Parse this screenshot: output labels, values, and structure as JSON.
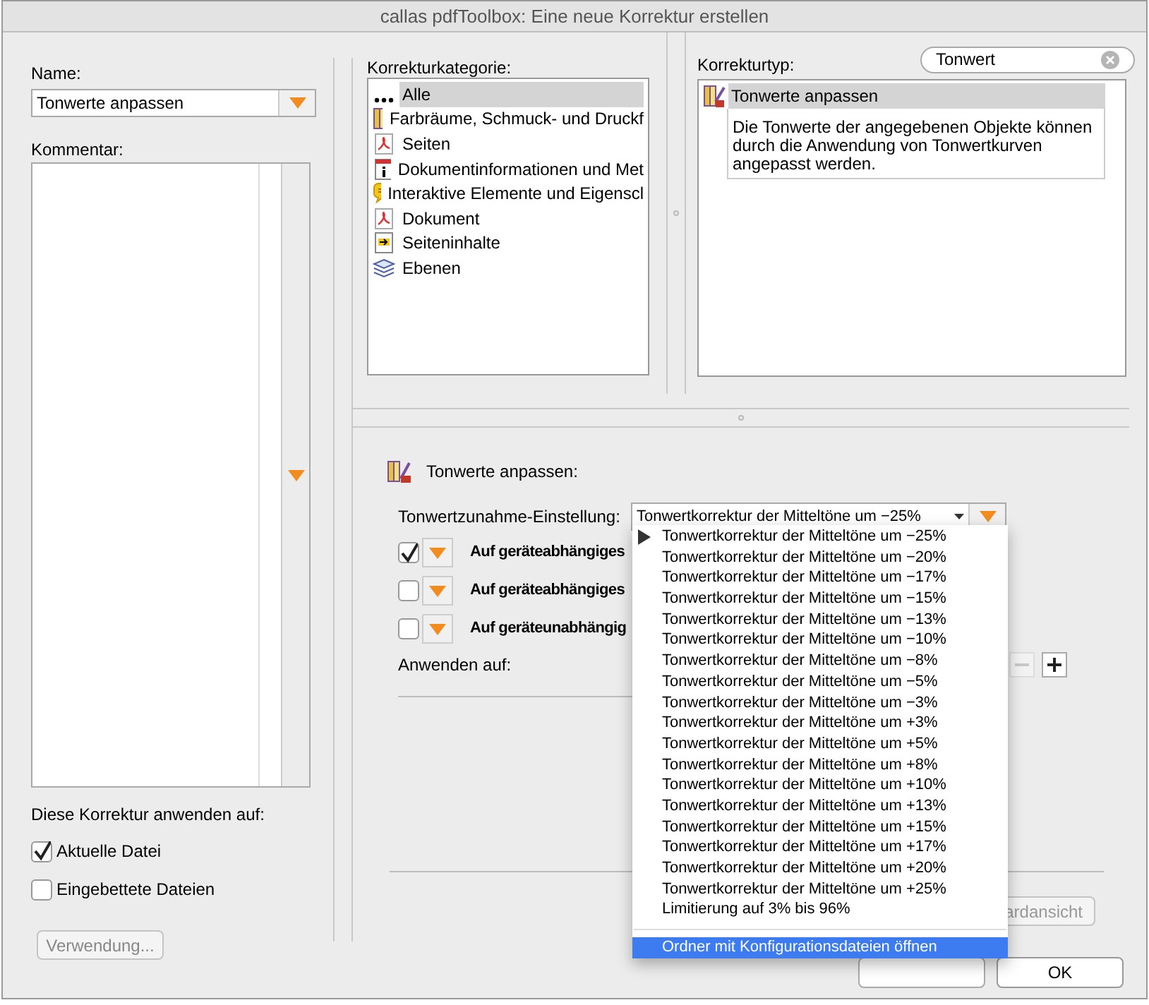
{
  "window": {
    "title": "callas pdfToolbox: Eine neue Korrektur erstellen"
  },
  "left": {
    "name_label": "Name:",
    "name_value": "Tonwerte anpassen",
    "comment_label": "Kommentar:",
    "apply_label": "Diese Korrektur anwenden auf:",
    "targets": [
      {
        "label": "Aktuelle Datei",
        "checked": true
      },
      {
        "label": "Eingebettete Dateien",
        "checked": false
      }
    ],
    "usage_button": {
      "label": "Verwendung...",
      "disabled": true
    }
  },
  "categories": {
    "label": "Korrekturkategorie:",
    "items": [
      {
        "label": "Alle",
        "kind": "dots",
        "selected": true
      },
      {
        "label": "Farbräume, Schmuck- und Druckf",
        "kind": "swatch",
        "selected": false
      },
      {
        "label": "Seiten",
        "kind": "pdf",
        "selected": false
      },
      {
        "label": "Dokumentinformationen und Met",
        "kind": "info",
        "selected": false
      },
      {
        "label": "Interaktive Elemente und Eigenscl",
        "kind": "comment",
        "selected": false
      },
      {
        "label": "Dokument",
        "kind": "pdf",
        "selected": false
      },
      {
        "label": "Seiteninhalte",
        "kind": "content",
        "selected": false
      },
      {
        "label": "Ebenen",
        "kind": "layers",
        "selected": false
      }
    ]
  },
  "types": {
    "label": "Korrekturtyp:",
    "search": {
      "value": "Tonwert"
    },
    "items": [
      {
        "label": "Tonwerte anpassen",
        "selected": true,
        "description": "Die Tonwerte der angegebenen Objekte können durch die Anwendung von Tonwertkurven angepasst werden."
      }
    ]
  },
  "details": {
    "title": "Tonwerte anpassen:",
    "setting_label": "Tonwertzunahme-Einstellung:",
    "setting_value": "Tonwertkorrektur der Mitteltöne um −25%",
    "options": [
      {
        "label": "Auf geräteabhängiges",
        "checked": true
      },
      {
        "label": "Auf geräteabhängiges",
        "checked": false
      },
      {
        "label": "Auf geräteunabhängig",
        "checked": false
      }
    ],
    "apply_to_label": "Anwenden auf:",
    "standard_button": "ardansicht"
  },
  "menu": {
    "items": [
      {
        "label": "Tonwertkorrektur der Mitteltöne um −25%",
        "selected": true
      },
      {
        "label": "Tonwertkorrektur der Mitteltöne um −20%",
        "selected": false
      },
      {
        "label": "Tonwertkorrektur der Mitteltöne um −17%",
        "selected": false
      },
      {
        "label": "Tonwertkorrektur der Mitteltöne um −15%",
        "selected": false
      },
      {
        "label": "Tonwertkorrektur der Mitteltöne um −13%",
        "selected": false
      },
      {
        "label": "Tonwertkorrektur der Mitteltöne um −10%",
        "selected": false
      },
      {
        "label": "Tonwertkorrektur der Mitteltöne um −8%",
        "selected": false
      },
      {
        "label": "Tonwertkorrektur der Mitteltöne um −5%",
        "selected": false
      },
      {
        "label": "Tonwertkorrektur der Mitteltöne um −3%",
        "selected": false
      },
      {
        "label": "Tonwertkorrektur der Mitteltöne um +3%",
        "selected": false
      },
      {
        "label": "Tonwertkorrektur der Mitteltöne um +5%",
        "selected": false
      },
      {
        "label": "Tonwertkorrektur der Mitteltöne um +8%",
        "selected": false
      },
      {
        "label": "Tonwertkorrektur der Mitteltöne um +10%",
        "selected": false
      },
      {
        "label": "Tonwertkorrektur der Mitteltöne um +13%",
        "selected": false
      },
      {
        "label": "Tonwertkorrektur der Mitteltöne um +15%",
        "selected": false
      },
      {
        "label": "Tonwertkorrektur der Mitteltöne um +17%",
        "selected": false
      },
      {
        "label": "Tonwertkorrektur der Mitteltöne um +20%",
        "selected": false
      },
      {
        "label": "Tonwertkorrektur der Mitteltöne um +25%",
        "selected": false
      },
      {
        "label": "Limitierung auf 3% bis 96%",
        "selected": false
      }
    ],
    "footer_item": {
      "label": "Ordner mit Konfigurationsdateien öffnen",
      "highlighted": true
    }
  },
  "buttons": {
    "ok": "OK"
  }
}
